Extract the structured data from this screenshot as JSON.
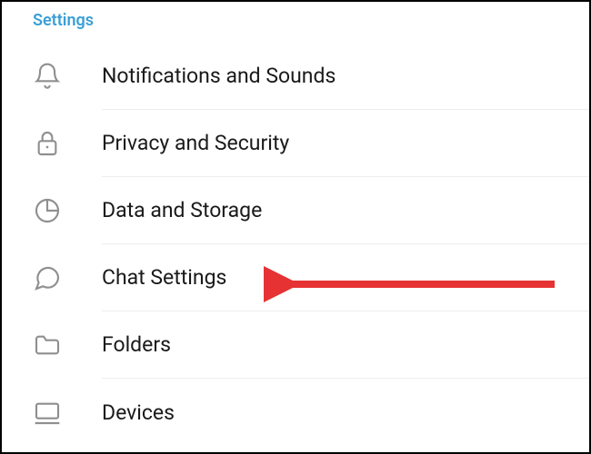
{
  "section_title": "Settings",
  "items": [
    {
      "id": "notifications",
      "label": "Notifications and Sounds",
      "icon": "bell-icon"
    },
    {
      "id": "privacy",
      "label": "Privacy and Security",
      "icon": "lock-icon"
    },
    {
      "id": "data",
      "label": "Data and Storage",
      "icon": "pie-chart-icon"
    },
    {
      "id": "chat",
      "label": "Chat Settings",
      "icon": "chat-bubble-icon"
    },
    {
      "id": "folders",
      "label": "Folders",
      "icon": "folder-icon"
    },
    {
      "id": "devices",
      "label": "Devices",
      "icon": "device-icon"
    }
  ],
  "annotation": {
    "target_item": "chat",
    "arrow_color": "#e63232"
  }
}
